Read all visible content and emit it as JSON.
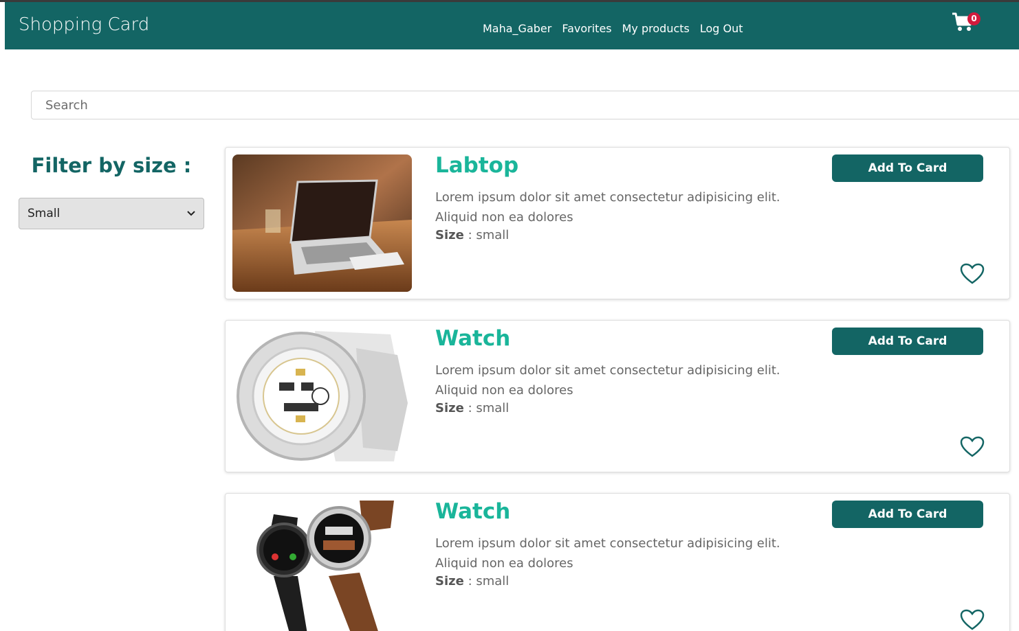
{
  "navbar": {
    "brand": "Shopping Card",
    "links": [
      "Maha_Gaber",
      "Favorites",
      "My products",
      "Log Out"
    ],
    "cart_count": "0"
  },
  "search": {
    "placeholder": "Search",
    "value": ""
  },
  "filter": {
    "title": "Filter by size :",
    "selected": "Small"
  },
  "products": [
    {
      "title": "Labtop",
      "description": "Lorem ipsum dolor sit amet consectetur adipisicing elit. Aliquid non ea dolores",
      "size_label": "Size",
      "size_value": ": small",
      "button": "Add To Card",
      "image": "laptop-photo"
    },
    {
      "title": "Watch",
      "description": "Lorem ipsum dolor sit amet consectetur adipisicing elit. Aliquid non ea dolores",
      "size_label": "Size",
      "size_value": ": small",
      "button": "Add To Card",
      "image": "white-watch-photo"
    },
    {
      "title": "Watch",
      "description": "Lorem ipsum dolor sit amet consectetur adipisicing elit. Aliquid non ea dolores",
      "size_label": "Size",
      "size_value": ": small",
      "button": "Add To Card",
      "image": "smartwatches-photo"
    }
  ],
  "colors": {
    "primary": "#136564",
    "accent_title": "#1ab59a",
    "badge": "#d11a3c"
  },
  "icons": {
    "cart": "shopping-cart-icon",
    "favorite": "heart-outline-icon",
    "select": "chevron-down-icon"
  }
}
